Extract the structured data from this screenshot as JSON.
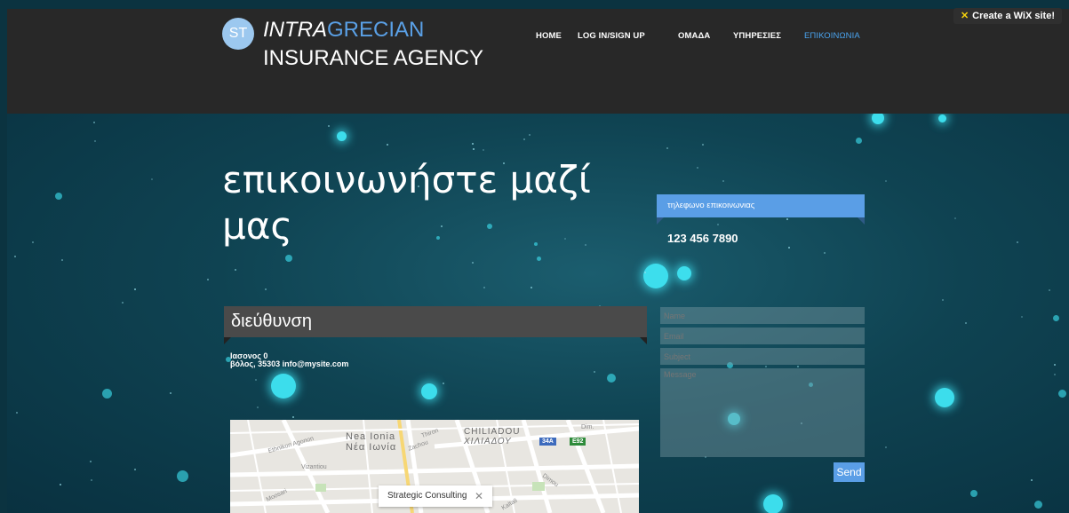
{
  "wix_badge": {
    "icon": "wix-x-icon",
    "label": "Create a WiX site!"
  },
  "brand": {
    "monogram": "ST",
    "line1_italic": "INTRA",
    "line1_rest": "GRECIAN",
    "line2": "INSURANCE AGENCY"
  },
  "nav": {
    "items": [
      "HOME",
      "LOG IN/SIGN UP",
      "ΟΜΑΔΑ",
      "ΥΠΗΡΕΣΙΕΣ",
      "ΕΠΙΚΟΙΝΩΝΙΑ"
    ],
    "active_color": "#4aa3ee"
  },
  "hero": {
    "title": "επικοινωνήστε μαζί μας"
  },
  "phone": {
    "heading": "τηλεφωνο επικοινωνιας",
    "number": "123 456 7890"
  },
  "address": {
    "heading": "διεύθυνση",
    "line1": "Ιασονος 0",
    "line2": "βόλος, 35303 info@mysite.com"
  },
  "form": {
    "name_placeholder": "Name",
    "email_placeholder": "Email",
    "subject_placeholder": "Subject",
    "message_placeholder": "Message",
    "send_label": "Send"
  },
  "map": {
    "area_label_latin": "Nea Ionia",
    "area_label_greek": "Νέα Ιωνία",
    "district_latin": "CHILIADOU",
    "district_greek": "ΧΙΛΙΑΔΟΥ",
    "road_34a": "34A",
    "road_e92": "E92",
    "streets": [
      "Ethnikon Agonon",
      "Vizantiou",
      "Zachou",
      "Thiron",
      "Dimou",
      "Dim.",
      "Moosari",
      "Kaltali"
    ],
    "popup_text": "Strategic Consulting",
    "close_symbol": "✕"
  },
  "colors": {
    "accent": "#5a9ee6",
    "header_bg": "#282828",
    "address_bar": "#4a4a4a"
  }
}
